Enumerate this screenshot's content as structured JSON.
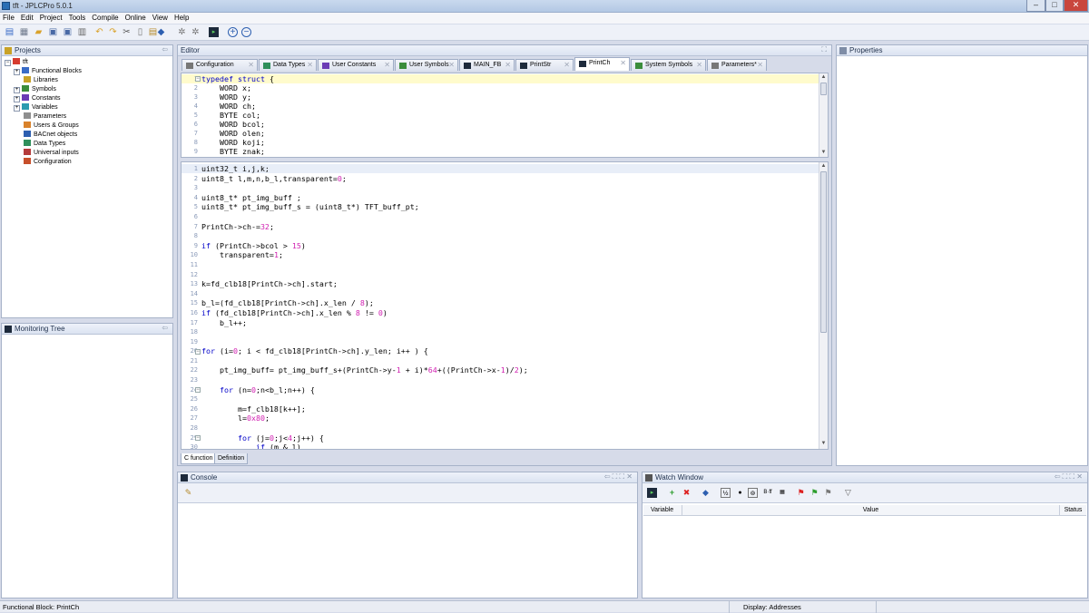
{
  "window": {
    "title": "tft - JPLCPro 5.0.1",
    "minimize": "–",
    "maximize": "□",
    "close": "✕"
  },
  "menu": [
    "File",
    "Edit",
    "Project",
    "Tools",
    "Compile",
    "Online",
    "View",
    "Help"
  ],
  "projects": {
    "title": "Projects",
    "tree": [
      {
        "label": "tft",
        "icon": "project-icon",
        "color": "#d63b2f",
        "expander": "−"
      },
      {
        "label": "Functional Blocks",
        "icon": "functional-blocks-icon",
        "color": "#3a6cc7",
        "expander": "+"
      },
      {
        "label": "Libraries",
        "icon": "libraries-icon",
        "color": "#c9a227",
        "expander": ""
      },
      {
        "label": "Symbols",
        "icon": "symbols-icon",
        "color": "#3b8d3b",
        "expander": "+"
      },
      {
        "label": "Constants",
        "icon": "constants-icon",
        "color": "#6a3bb5",
        "expander": "+"
      },
      {
        "label": "Variables",
        "icon": "variables-icon",
        "color": "#2b9bb0",
        "expander": "+"
      },
      {
        "label": "Parameters",
        "icon": "parameters-icon",
        "color": "#8f8f8f",
        "expander": ""
      },
      {
        "label": "Users & Groups",
        "icon": "users-groups-icon",
        "color": "#d9822b",
        "expander": ""
      },
      {
        "label": "BACnet objects",
        "icon": "bacnet-objects-icon",
        "color": "#2d5fb0",
        "expander": ""
      },
      {
        "label": "Data Types",
        "icon": "data-types-icon",
        "color": "#2f8f5b",
        "expander": ""
      },
      {
        "label": "Universal inputs",
        "icon": "universal-inputs-icon",
        "color": "#b53b3b",
        "expander": ""
      },
      {
        "label": "Configuration",
        "icon": "configuration-icon",
        "color": "#c74f2b",
        "expander": ""
      }
    ]
  },
  "monitoring": {
    "title": "Monitoring Tree"
  },
  "editor": {
    "title": "Editor",
    "tabs": [
      "Configuration",
      "Data Types",
      "User Constants",
      "User Symbols",
      "MAIN_FB",
      "PrintStr",
      "PrintCh",
      "System Symbols",
      "Parameters*"
    ],
    "active_tab": "PrintCh",
    "struct_lines": [
      {
        "n": "1",
        "t": "typedef struct {",
        "fold": "−"
      },
      {
        "n": "2",
        "t": "    WORD x;",
        "fold": ""
      },
      {
        "n": "3",
        "t": "    WORD y;",
        "fold": ""
      },
      {
        "n": "4",
        "t": "    WORD ch;",
        "fold": ""
      },
      {
        "n": "5",
        "t": "    BYTE col;",
        "fold": ""
      },
      {
        "n": "6",
        "t": "    WORD bcol;",
        "fold": ""
      },
      {
        "n": "7",
        "t": "    WORD olen;",
        "fold": ""
      },
      {
        "n": "8",
        "t": "    WORD koji;",
        "fold": ""
      },
      {
        "n": "9",
        "t": "    BYTE znak;",
        "fold": ""
      }
    ],
    "code_lines": [
      {
        "n": "1",
        "t": "uint32_t i,j,k;",
        "fold": ""
      },
      {
        "n": "2",
        "t": "uint8_t l,m,n,b_l,transparent=0;",
        "fold": ""
      },
      {
        "n": "3",
        "t": "",
        "fold": ""
      },
      {
        "n": "4",
        "t": "uint8_t* pt_img_buff ;",
        "fold": ""
      },
      {
        "n": "5",
        "t": "uint8_t* pt_img_buff_s = (uint8_t*) TFT_buff_pt;",
        "fold": ""
      },
      {
        "n": "6",
        "t": "",
        "fold": ""
      },
      {
        "n": "7",
        "t": "PrintCh->ch-=32;",
        "fold": ""
      },
      {
        "n": "8",
        "t": "",
        "fold": ""
      },
      {
        "n": "9",
        "t": "if (PrintCh->bcol > 15)",
        "fold": ""
      },
      {
        "n": "10",
        "t": "    transparent=1;",
        "fold": ""
      },
      {
        "n": "11",
        "t": "",
        "fold": ""
      },
      {
        "n": "12",
        "t": "",
        "fold": ""
      },
      {
        "n": "13",
        "t": "k=fd_clb18[PrintCh->ch].start;",
        "fold": ""
      },
      {
        "n": "14",
        "t": "",
        "fold": ""
      },
      {
        "n": "15",
        "t": "b_l=(fd_clb18[PrintCh->ch].x_len / 8);",
        "fold": ""
      },
      {
        "n": "16",
        "t": "if (fd_clb18[PrintCh->ch].x_len % 8 != 0)",
        "fold": ""
      },
      {
        "n": "17",
        "t": "    b_l++;",
        "fold": ""
      },
      {
        "n": "18",
        "t": "",
        "fold": ""
      },
      {
        "n": "19",
        "t": "",
        "fold": ""
      },
      {
        "n": "20",
        "t": "for (i=0; i < fd_clb18[PrintCh->ch].y_len; i++ ) {",
        "fold": "−"
      },
      {
        "n": "21",
        "t": "",
        "fold": ""
      },
      {
        "n": "22",
        "t": "    pt_img_buff= pt_img_buff_s+(PrintCh->y-1 + i)*64+((PrintCh->x-1)/2);",
        "fold": ""
      },
      {
        "n": "23",
        "t": "",
        "fold": ""
      },
      {
        "n": "24",
        "t": "    for (n=0;n<b_l;n++) {",
        "fold": "−"
      },
      {
        "n": "25",
        "t": "",
        "fold": ""
      },
      {
        "n": "26",
        "t": "        m=f_clb18[k++];",
        "fold": ""
      },
      {
        "n": "27",
        "t": "        l=0x80;",
        "fold": ""
      },
      {
        "n": "28",
        "t": "",
        "fold": ""
      },
      {
        "n": "29",
        "t": "        for (j=0;j<4;j++) {",
        "fold": "−"
      },
      {
        "n": "30",
        "t": "            if (m & l)",
        "fold": ""
      }
    ],
    "bottom_tabs": [
      "C function",
      "Definition"
    ]
  },
  "properties": {
    "title": "Properties"
  },
  "console": {
    "title": "Console"
  },
  "watch": {
    "title": "Watch Window",
    "columns": [
      "Variable",
      "Value",
      "Status"
    ]
  },
  "status": {
    "left": "Functional Block: PrintCh",
    "right": "Display: Addresses"
  },
  "toolbar_icons": [
    "new-icon",
    "open-icon",
    "open-folder-icon",
    "save-icon",
    "save-all-icon",
    "print-icon",
    "undo-icon",
    "redo-icon",
    "cut-icon",
    "copy-icon",
    "paste-icon",
    "compile-icon",
    "build-icon",
    "settings-icon",
    "terminal-icon",
    "zoom-in-icon",
    "zoom-out-icon"
  ]
}
